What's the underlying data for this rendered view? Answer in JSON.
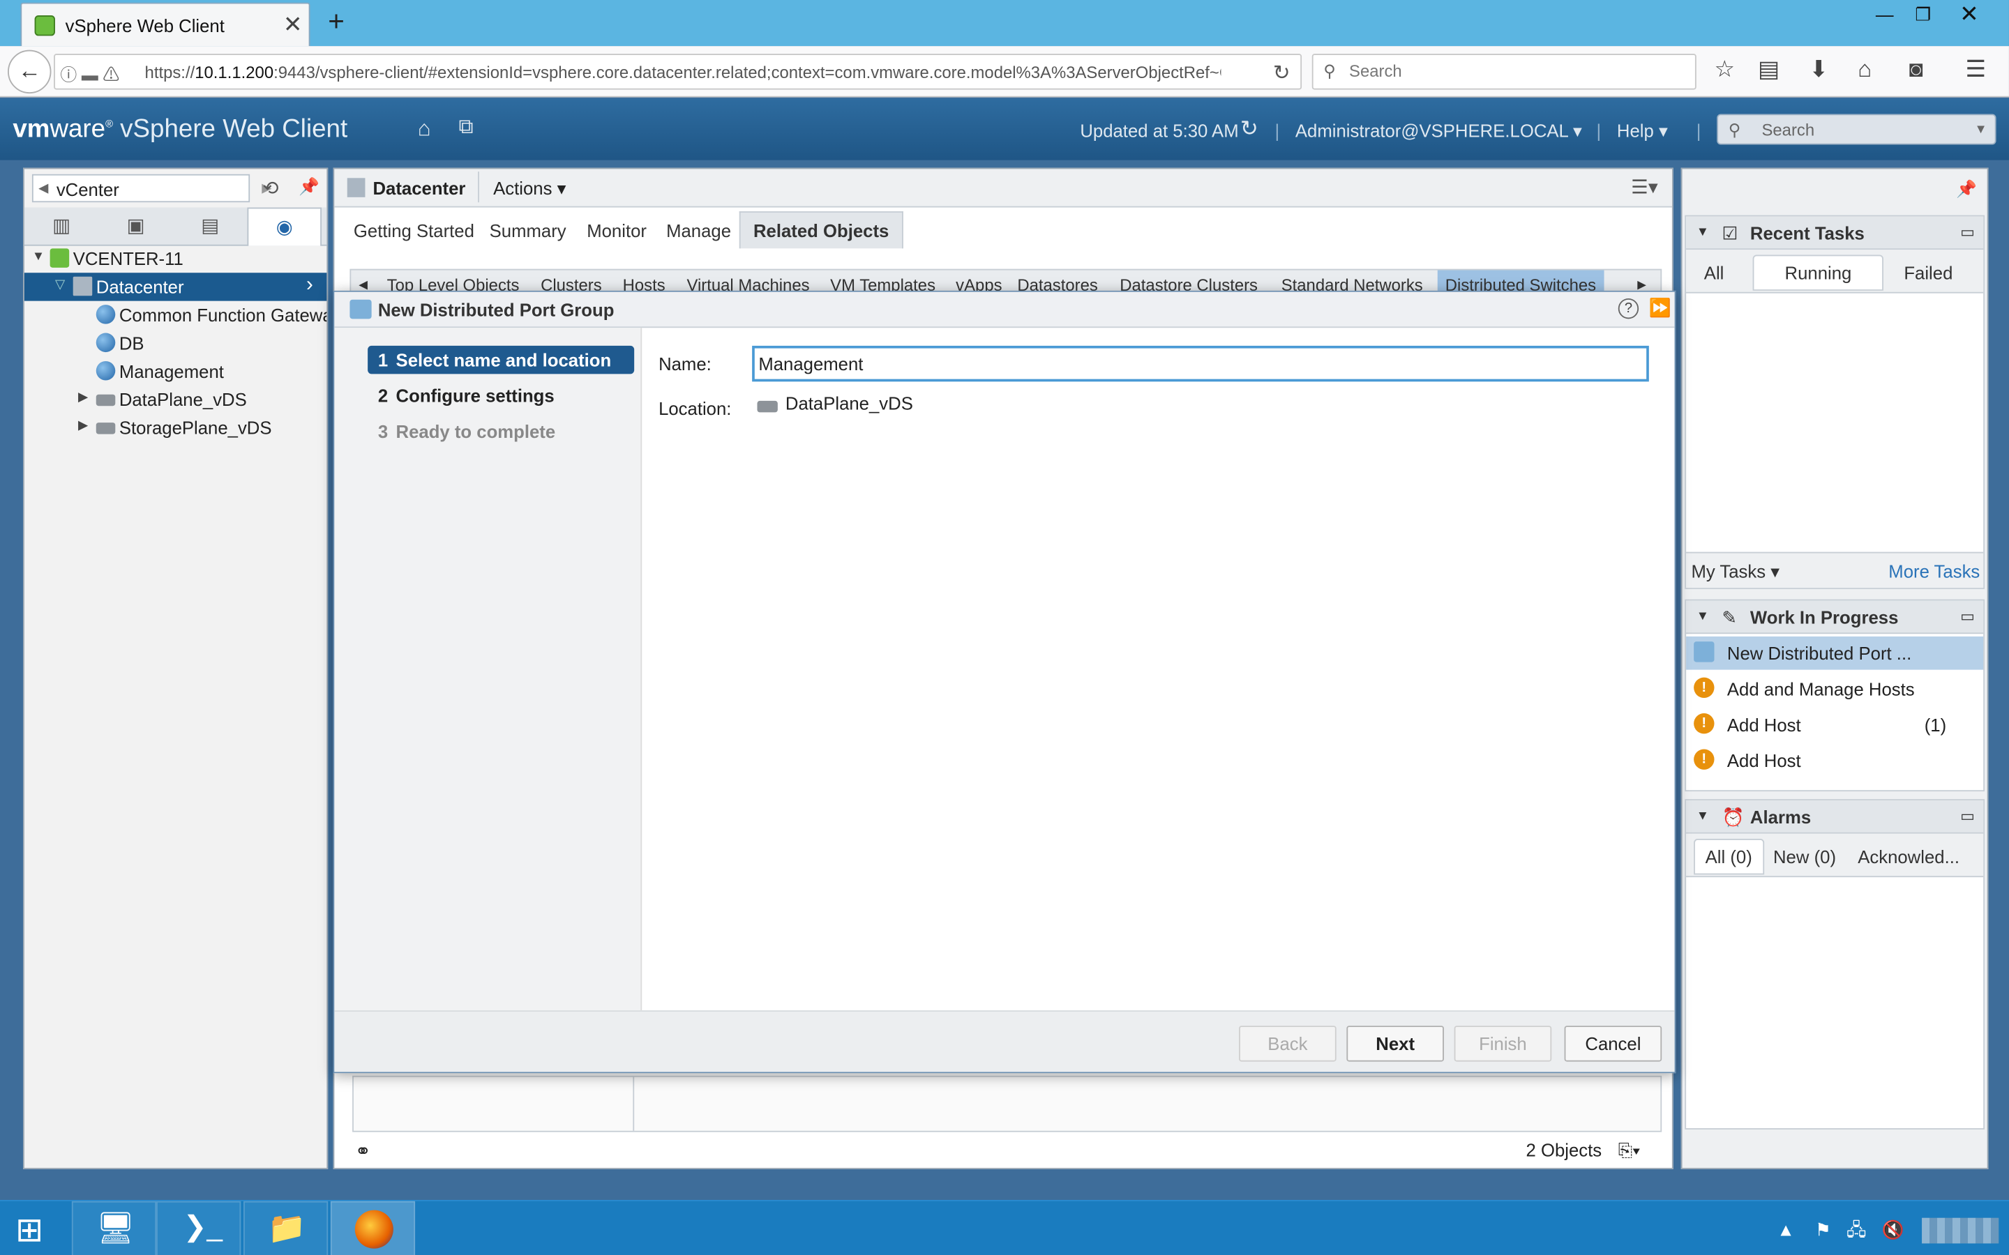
{
  "browser": {
    "tab_title": "vSphere Web Client",
    "url_prefix": "https://",
    "url_host": "10.1.1.200",
    "url_rest": ":9443/vsphere-client/#extensionId=vsphere.core.datacenter.related;context=com.vmware.core.model%3A%3AServerObjectRef~C",
    "search_placeholder": "Search"
  },
  "app": {
    "brand_vm": "vm",
    "brand_ware": "ware",
    "brand_product": "vSphere Web Client",
    "updated_at": "Updated at 5:30 AM",
    "user": "Administrator@VSPHERE.LOCAL",
    "help": "Help",
    "search_placeholder": "Search"
  },
  "navigator": {
    "breadcrumb": "vCenter",
    "tree": [
      {
        "label": "VCENTER-11"
      },
      {
        "label": "Datacenter"
      },
      {
        "label": "Common Function Gatewa"
      },
      {
        "label": "DB"
      },
      {
        "label": "Management"
      },
      {
        "label": "DataPlane_vDS"
      },
      {
        "label": "StoragePlane_vDS"
      }
    ]
  },
  "main": {
    "object_title": "Datacenter",
    "actions": "Actions",
    "tabs": [
      "Getting Started",
      "Summary",
      "Monitor",
      "Manage",
      "Related Objects"
    ],
    "active_tab": "Related Objects",
    "related_tabs": [
      "Top Level Objects",
      "Clusters",
      "Hosts",
      "Virtual Machines",
      "VM Templates",
      "vApps",
      "Datastores",
      "Datastore Clusters",
      "Standard Networks",
      "Distributed Switches"
    ],
    "object_count": "2 Objects"
  },
  "dialog": {
    "title": "New Distributed Port Group",
    "steps": [
      {
        "num": "1",
        "label": "Select name and location",
        "state": "active"
      },
      {
        "num": "2",
        "label": "Configure settings",
        "state": "normal"
      },
      {
        "num": "3",
        "label": "Ready to complete",
        "state": "disabled"
      }
    ],
    "name_label": "Name:",
    "name_value": "Management",
    "location_label": "Location:",
    "location_value": "DataPlane_vDS",
    "buttons": {
      "back": "Back",
      "next": "Next",
      "finish": "Finish",
      "cancel": "Cancel"
    }
  },
  "recent_tasks": {
    "title": "Recent Tasks",
    "tabs": [
      "All",
      "Running",
      "Failed"
    ],
    "active_tab": "Running",
    "my_tasks": "My Tasks",
    "more_tasks": "More Tasks"
  },
  "work_in_progress": {
    "title": "Work In Progress",
    "items": [
      {
        "label": "New Distributed Port ...",
        "count": ""
      },
      {
        "label": "Add and Manage Hosts",
        "count": ""
      },
      {
        "label": "Add Host",
        "count": "(1)"
      },
      {
        "label": "Add Host",
        "count": ""
      }
    ]
  },
  "alarms": {
    "title": "Alarms",
    "tabs": [
      "All (0)",
      "New (0)",
      "Acknowled..."
    ]
  },
  "colors": {
    "brand_blue": "#1f5686",
    "selection_blue": "#1b5a8f",
    "warning_orange": "#e8910c"
  }
}
